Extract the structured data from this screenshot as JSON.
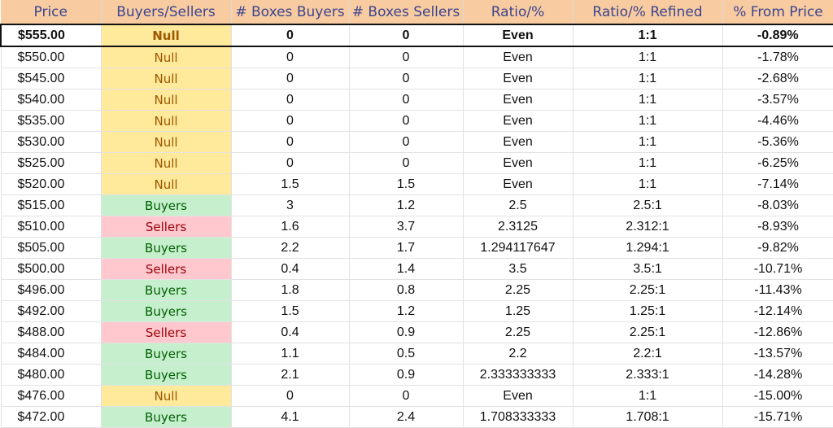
{
  "headers": [
    "Price",
    "Buyers/Sellers",
    "# Boxes Buyers",
    "# Boxes Sellers",
    "Ratio/%",
    "Ratio/% Refined",
    "% From Price"
  ],
  "rows": [
    [
      "$555.00",
      "Null",
      "0",
      "0",
      "Even",
      "1:1",
      "-0.89%"
    ],
    [
      "$550.00",
      "Null",
      "0",
      "0",
      "Even",
      "1:1",
      "-1.78%"
    ],
    [
      "$545.00",
      "Null",
      "0",
      "0",
      "Even",
      "1:1",
      "-2.68%"
    ],
    [
      "$540.00",
      "Null",
      "0",
      "0",
      "Even",
      "1:1",
      "-3.57%"
    ],
    [
      "$535.00",
      "Null",
      "0",
      "0",
      "Even",
      "1:1",
      "-4.46%"
    ],
    [
      "$530.00",
      "Null",
      "0",
      "0",
      "Even",
      "1:1",
      "-5.36%"
    ],
    [
      "$525.00",
      "Null",
      "0",
      "0",
      "Even",
      "1:1",
      "-6.25%"
    ],
    [
      "$520.00",
      "Null",
      "1.5",
      "1.5",
      "Even",
      "1:1",
      "-7.14%"
    ],
    [
      "$515.00",
      "Buyers",
      "3",
      "1.2",
      "2.5",
      "2.5:1",
      "-8.03%"
    ],
    [
      "$510.00",
      "Sellers",
      "1.6",
      "3.7",
      "2.3125",
      "2.312:1",
      "-8.93%"
    ],
    [
      "$505.00",
      "Buyers",
      "2.2",
      "1.7",
      "1.294117647",
      "1.294:1",
      "-9.82%"
    ],
    [
      "$500.00",
      "Sellers",
      "0.4",
      "1.4",
      "3.5",
      "3.5:1",
      "-10.71%"
    ],
    [
      "$496.00",
      "Buyers",
      "1.8",
      "0.8",
      "2.25",
      "2.25:1",
      "-11.43%"
    ],
    [
      "$492.00",
      "Buyers",
      "1.5",
      "1.2",
      "1.25",
      "1.25:1",
      "-12.14%"
    ],
    [
      "$488.00",
      "Sellers",
      "0.4",
      "0.9",
      "2.25",
      "2.25:1",
      "-12.86%"
    ],
    [
      "$484.00",
      "Buyers",
      "1.1",
      "0.5",
      "2.2",
      "2.2:1",
      "-13.57%"
    ],
    [
      "$480.00",
      "Buyers",
      "2.1",
      "0.9",
      "2.333333333",
      "2.333:1",
      "-14.28%"
    ],
    [
      "$476.00",
      "Null",
      "0",
      "0",
      "Even",
      "1:1",
      "-15.00%"
    ],
    [
      "$472.00",
      "Buyers",
      "4.1",
      "2.4",
      "1.708333333",
      "1.708:1",
      "-15.71%"
    ]
  ],
  "colors": {
    "header_bg": "#F8CBA0",
    "header_text": "#3C4590",
    "null_bg": "#FFE99B",
    "null_text": "#9C5700",
    "buyers_bg": "#C6EFCE",
    "buyers_text": "#006100",
    "sellers_bg": "#FFC7CE",
    "sellers_text": "#9C0006"
  }
}
